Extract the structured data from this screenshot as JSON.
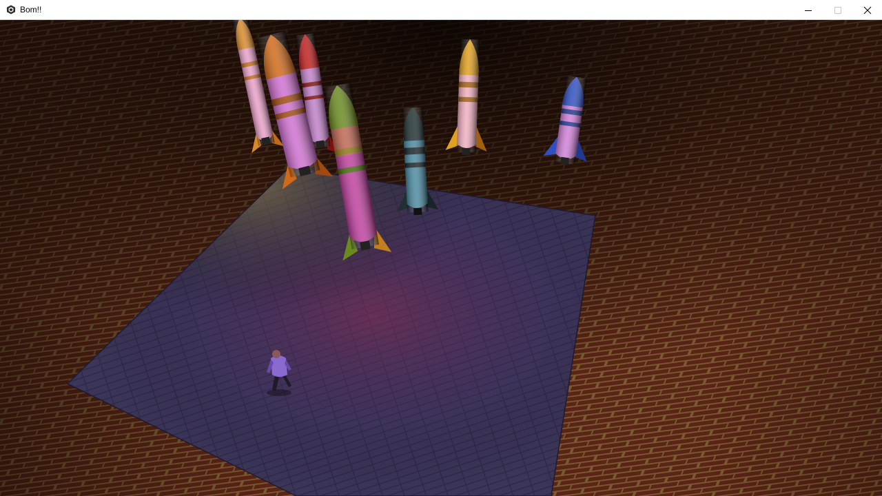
{
  "window": {
    "title": "Bom!!",
    "icon": "game-engine-icon",
    "buttons": {
      "minimize": "minimize-icon",
      "maximize": "maximize-icon",
      "close": "close-icon"
    }
  },
  "scene": {
    "floor_colors": {
      "brick": "#5a2416",
      "mortar": "#8a6b3a",
      "pad": "#3a3356",
      "pad_glow": "#6a2f4a"
    },
    "rockets": [
      {
        "name": "rocket-orange-left",
        "body": "#e8a0c8",
        "nose": "#d88a2a",
        "band": "#c06a1a"
      },
      {
        "name": "rocket-magenta-big",
        "body": "#d070d0",
        "nose": "#d06a1a",
        "band": "#a04a10"
      },
      {
        "name": "rocket-red",
        "body": "#c080c8",
        "nose": "#c02020",
        "band": "#801010"
      },
      {
        "name": "rocket-green",
        "body": "#c040a0",
        "nose": "#6a8a20",
        "band": "#4a6a10"
      },
      {
        "name": "rocket-dark-teal",
        "body": "#4a8aa0",
        "nose": "#203030",
        "band": "#182428"
      },
      {
        "name": "rocket-yellow",
        "body": "#f0b0c0",
        "nose": "#e0a020",
        "band": "#a06010"
      },
      {
        "name": "rocket-blue",
        "body": "#d080d8",
        "nose": "#3050c0",
        "band": "#203890"
      }
    ],
    "player": "player-character"
  }
}
